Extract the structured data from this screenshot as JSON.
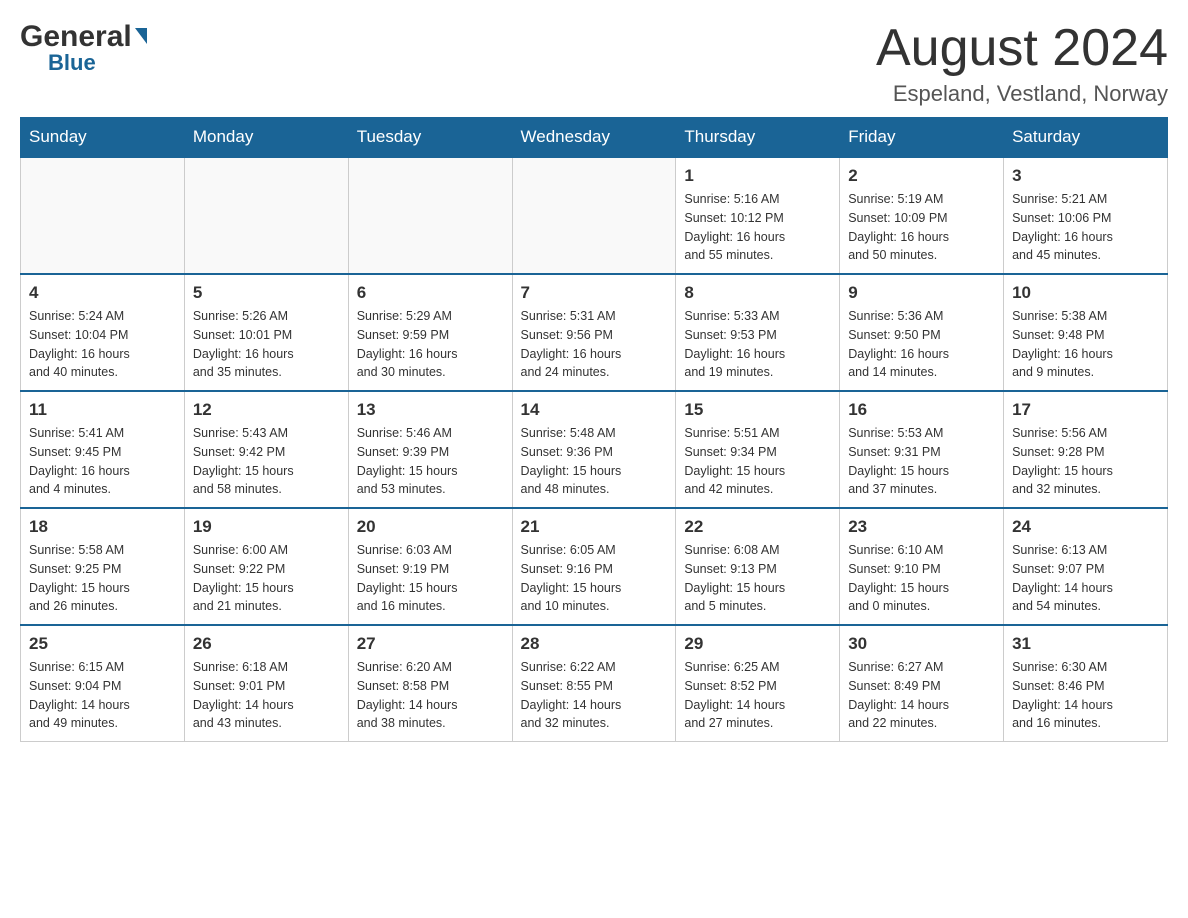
{
  "header": {
    "logo_general": "General",
    "logo_arrow": "▲",
    "logo_blue": "Blue",
    "month_title": "August 2024",
    "location": "Espeland, Vestland, Norway"
  },
  "days_of_week": [
    "Sunday",
    "Monday",
    "Tuesday",
    "Wednesday",
    "Thursday",
    "Friday",
    "Saturday"
  ],
  "weeks": [
    [
      {
        "day": "",
        "info": ""
      },
      {
        "day": "",
        "info": ""
      },
      {
        "day": "",
        "info": ""
      },
      {
        "day": "",
        "info": ""
      },
      {
        "day": "1",
        "info": "Sunrise: 5:16 AM\nSunset: 10:12 PM\nDaylight: 16 hours\nand 55 minutes."
      },
      {
        "day": "2",
        "info": "Sunrise: 5:19 AM\nSunset: 10:09 PM\nDaylight: 16 hours\nand 50 minutes."
      },
      {
        "day": "3",
        "info": "Sunrise: 5:21 AM\nSunset: 10:06 PM\nDaylight: 16 hours\nand 45 minutes."
      }
    ],
    [
      {
        "day": "4",
        "info": "Sunrise: 5:24 AM\nSunset: 10:04 PM\nDaylight: 16 hours\nand 40 minutes."
      },
      {
        "day": "5",
        "info": "Sunrise: 5:26 AM\nSunset: 10:01 PM\nDaylight: 16 hours\nand 35 minutes."
      },
      {
        "day": "6",
        "info": "Sunrise: 5:29 AM\nSunset: 9:59 PM\nDaylight: 16 hours\nand 30 minutes."
      },
      {
        "day": "7",
        "info": "Sunrise: 5:31 AM\nSunset: 9:56 PM\nDaylight: 16 hours\nand 24 minutes."
      },
      {
        "day": "8",
        "info": "Sunrise: 5:33 AM\nSunset: 9:53 PM\nDaylight: 16 hours\nand 19 minutes."
      },
      {
        "day": "9",
        "info": "Sunrise: 5:36 AM\nSunset: 9:50 PM\nDaylight: 16 hours\nand 14 minutes."
      },
      {
        "day": "10",
        "info": "Sunrise: 5:38 AM\nSunset: 9:48 PM\nDaylight: 16 hours\nand 9 minutes."
      }
    ],
    [
      {
        "day": "11",
        "info": "Sunrise: 5:41 AM\nSunset: 9:45 PM\nDaylight: 16 hours\nand 4 minutes."
      },
      {
        "day": "12",
        "info": "Sunrise: 5:43 AM\nSunset: 9:42 PM\nDaylight: 15 hours\nand 58 minutes."
      },
      {
        "day": "13",
        "info": "Sunrise: 5:46 AM\nSunset: 9:39 PM\nDaylight: 15 hours\nand 53 minutes."
      },
      {
        "day": "14",
        "info": "Sunrise: 5:48 AM\nSunset: 9:36 PM\nDaylight: 15 hours\nand 48 minutes."
      },
      {
        "day": "15",
        "info": "Sunrise: 5:51 AM\nSunset: 9:34 PM\nDaylight: 15 hours\nand 42 minutes."
      },
      {
        "day": "16",
        "info": "Sunrise: 5:53 AM\nSunset: 9:31 PM\nDaylight: 15 hours\nand 37 minutes."
      },
      {
        "day": "17",
        "info": "Sunrise: 5:56 AM\nSunset: 9:28 PM\nDaylight: 15 hours\nand 32 minutes."
      }
    ],
    [
      {
        "day": "18",
        "info": "Sunrise: 5:58 AM\nSunset: 9:25 PM\nDaylight: 15 hours\nand 26 minutes."
      },
      {
        "day": "19",
        "info": "Sunrise: 6:00 AM\nSunset: 9:22 PM\nDaylight: 15 hours\nand 21 minutes."
      },
      {
        "day": "20",
        "info": "Sunrise: 6:03 AM\nSunset: 9:19 PM\nDaylight: 15 hours\nand 16 minutes."
      },
      {
        "day": "21",
        "info": "Sunrise: 6:05 AM\nSunset: 9:16 PM\nDaylight: 15 hours\nand 10 minutes."
      },
      {
        "day": "22",
        "info": "Sunrise: 6:08 AM\nSunset: 9:13 PM\nDaylight: 15 hours\nand 5 minutes."
      },
      {
        "day": "23",
        "info": "Sunrise: 6:10 AM\nSunset: 9:10 PM\nDaylight: 15 hours\nand 0 minutes."
      },
      {
        "day": "24",
        "info": "Sunrise: 6:13 AM\nSunset: 9:07 PM\nDaylight: 14 hours\nand 54 minutes."
      }
    ],
    [
      {
        "day": "25",
        "info": "Sunrise: 6:15 AM\nSunset: 9:04 PM\nDaylight: 14 hours\nand 49 minutes."
      },
      {
        "day": "26",
        "info": "Sunrise: 6:18 AM\nSunset: 9:01 PM\nDaylight: 14 hours\nand 43 minutes."
      },
      {
        "day": "27",
        "info": "Sunrise: 6:20 AM\nSunset: 8:58 PM\nDaylight: 14 hours\nand 38 minutes."
      },
      {
        "day": "28",
        "info": "Sunrise: 6:22 AM\nSunset: 8:55 PM\nDaylight: 14 hours\nand 32 minutes."
      },
      {
        "day": "29",
        "info": "Sunrise: 6:25 AM\nSunset: 8:52 PM\nDaylight: 14 hours\nand 27 minutes."
      },
      {
        "day": "30",
        "info": "Sunrise: 6:27 AM\nSunset: 8:49 PM\nDaylight: 14 hours\nand 22 minutes."
      },
      {
        "day": "31",
        "info": "Sunrise: 6:30 AM\nSunset: 8:46 PM\nDaylight: 14 hours\nand 16 minutes."
      }
    ]
  ]
}
